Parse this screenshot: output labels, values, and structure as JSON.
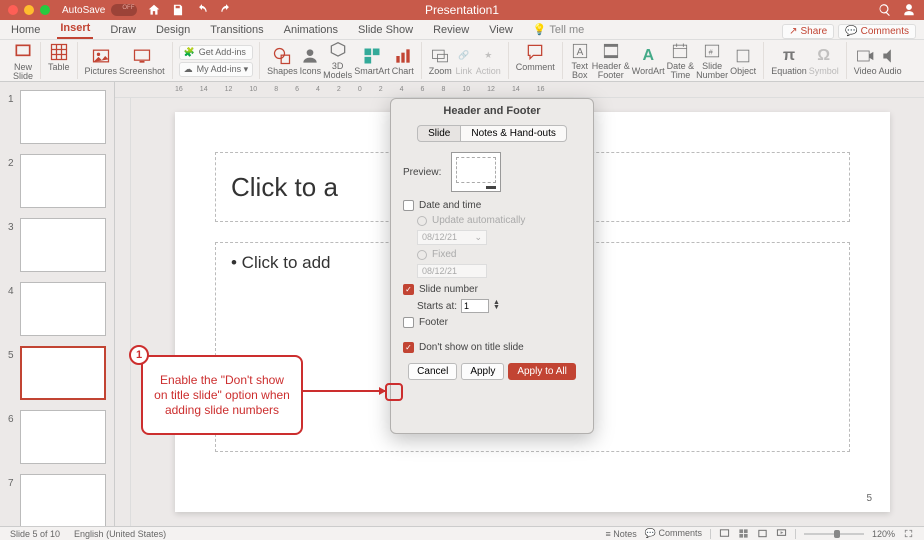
{
  "titlebar": {
    "autosave_label": "AutoSave",
    "doc_title": "Presentation1"
  },
  "tabs": {
    "home": "Home",
    "insert": "Insert",
    "draw": "Draw",
    "design": "Design",
    "transitions": "Transitions",
    "animations": "Animations",
    "slideshow": "Slide Show",
    "review": "Review",
    "view": "View",
    "tellme": "Tell me",
    "share": "Share",
    "comments": "Comments"
  },
  "ribbon": {
    "new_slide": "New\nSlide",
    "table": "Table",
    "pictures": "Pictures",
    "screenshot": "Screenshot",
    "get_addins": "Get Add-ins",
    "my_addins": "My Add-ins ▾",
    "shapes": "Shapes",
    "icons": "Icons",
    "models3d": "3D\nModels",
    "smartart": "SmartArt",
    "chart": "Chart",
    "zoom": "Zoom",
    "link": "Link",
    "action": "Action",
    "comment": "Comment",
    "textbox": "Text\nBox",
    "headerfooter": "Header &\nFooter",
    "wordart": "WordArt",
    "datetime": "Date &\nTime",
    "slidenum": "Slide\nNumber",
    "object": "Object",
    "equation": "Equation",
    "symbol": "Symbol",
    "video": "Video",
    "audio": "Audio"
  },
  "ruler_marks": [
    "16",
    "14",
    "12",
    "10",
    "8",
    "6",
    "4",
    "2",
    "0",
    "2",
    "4",
    "6",
    "8",
    "10",
    "12",
    "14",
    "16"
  ],
  "thumbs": [
    {
      "n": "1"
    },
    {
      "n": "2"
    },
    {
      "n": "3"
    },
    {
      "n": "4"
    },
    {
      "n": "5"
    },
    {
      "n": "6"
    },
    {
      "n": "7"
    }
  ],
  "slide": {
    "title_placeholder": "Click to a",
    "body_placeholder": "• Click to add",
    "page_number": "5"
  },
  "dialog": {
    "title": "Header and Footer",
    "tab_slide": "Slide",
    "tab_notes": "Notes & Hand-outs",
    "preview_label": "Preview:",
    "date_time": "Date and time",
    "update_auto": "Update automatically",
    "fixed": "Fixed",
    "date_value": "08/12/21",
    "slide_number": "Slide number",
    "starts_at": "Starts at:",
    "starts_at_value": "1",
    "footer": "Footer",
    "dont_show": "Don't show on title slide",
    "cancel": "Cancel",
    "apply": "Apply",
    "apply_all": "Apply to All"
  },
  "callout": {
    "badge": "1",
    "text": "Enable the \"Don't show on title slide\" option when adding slide numbers"
  },
  "status": {
    "slide_of": "Slide 5 of 10",
    "lang": "English (United States)",
    "notes": "Notes",
    "comments_label": "Comments",
    "zoom": "120%"
  }
}
